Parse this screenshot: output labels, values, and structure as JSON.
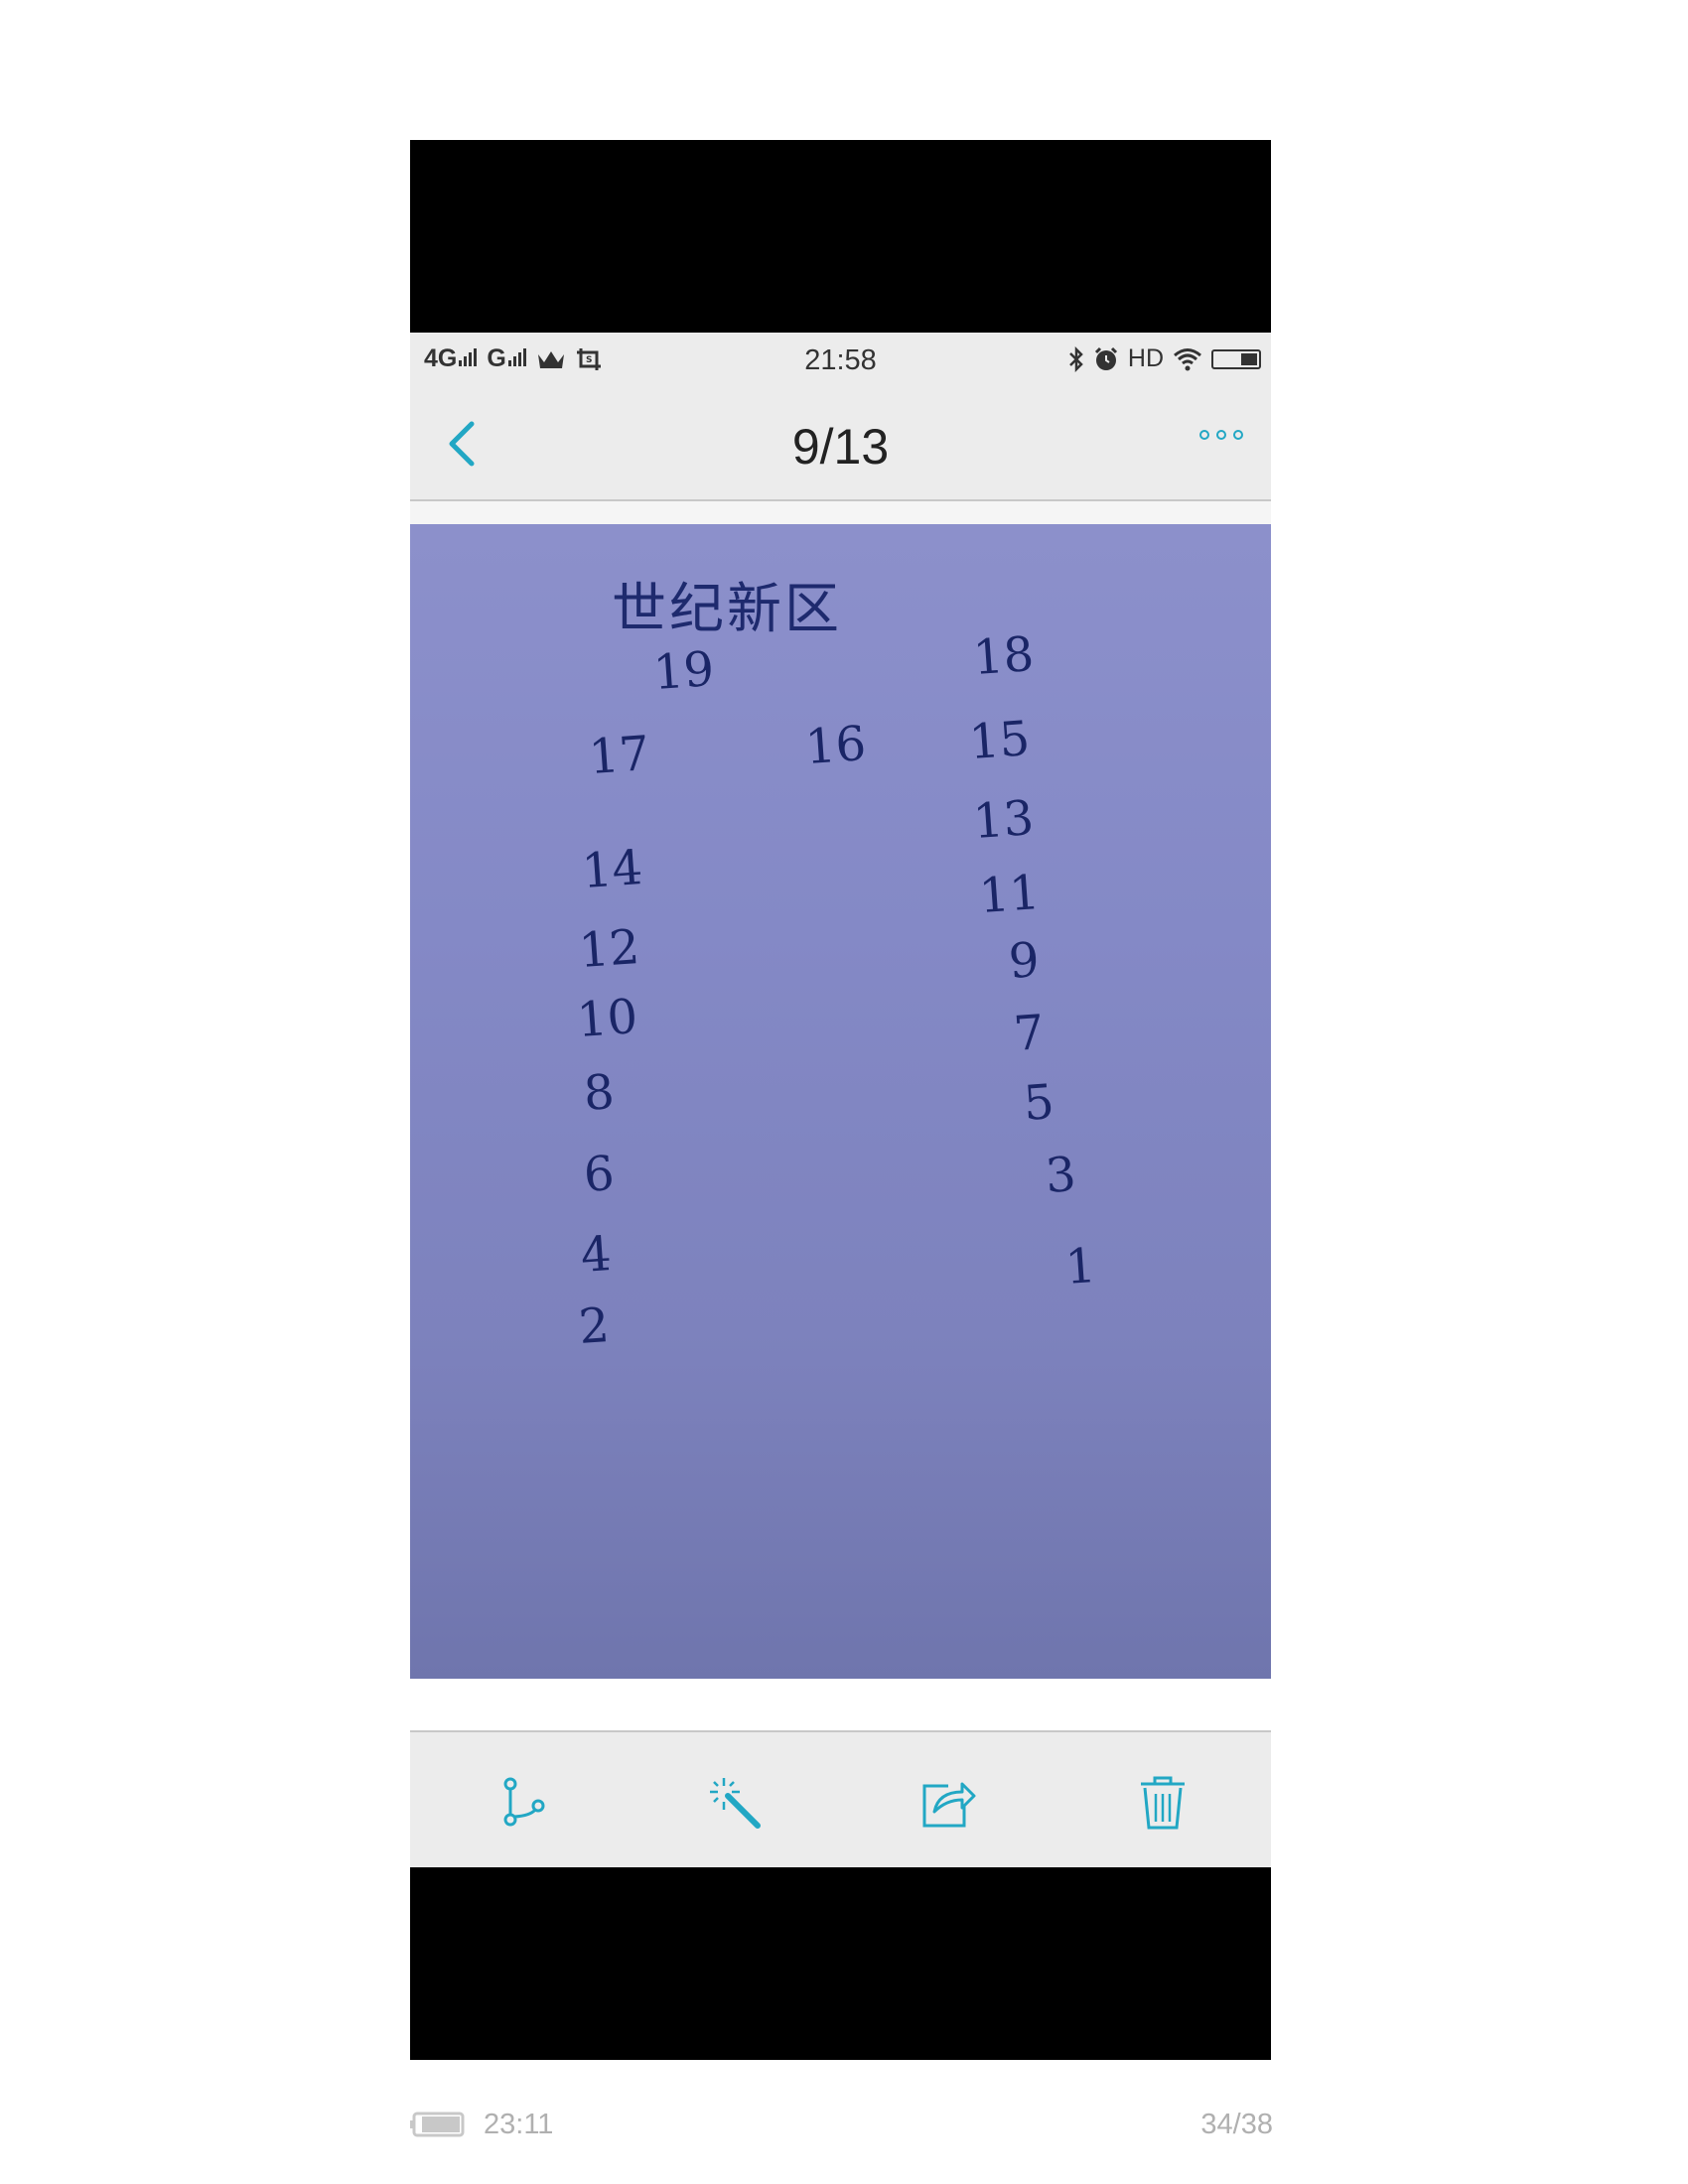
{
  "status_bar": {
    "signal_1": "4G",
    "signal_2": "G",
    "time": "21:58",
    "hd": "HD",
    "icons": [
      "signal-4g-icon",
      "signal-icon",
      "crown-icon",
      "screenshot-icon",
      "bluetooth-icon",
      "alarm-icon",
      "wifi-icon",
      "battery-icon"
    ]
  },
  "nav": {
    "page_counter": "9/13",
    "icons": [
      "back-arrow-icon",
      "more-dots-icon"
    ],
    "accent": "#22a7c4"
  },
  "photo": {
    "title": "世纪新区",
    "numbers": [
      "19",
      "18",
      "17",
      "16",
      "15",
      "13",
      "14",
      "11",
      "12",
      "9",
      "10",
      "7",
      "8",
      "5",
      "6",
      "3",
      "4",
      "1",
      "2"
    ]
  },
  "toolbar": {
    "icons": [
      "branch-icon",
      "magic-wand-icon",
      "share-icon",
      "trash-icon"
    ]
  },
  "footer": {
    "time": "23:11",
    "page": "34/38"
  }
}
